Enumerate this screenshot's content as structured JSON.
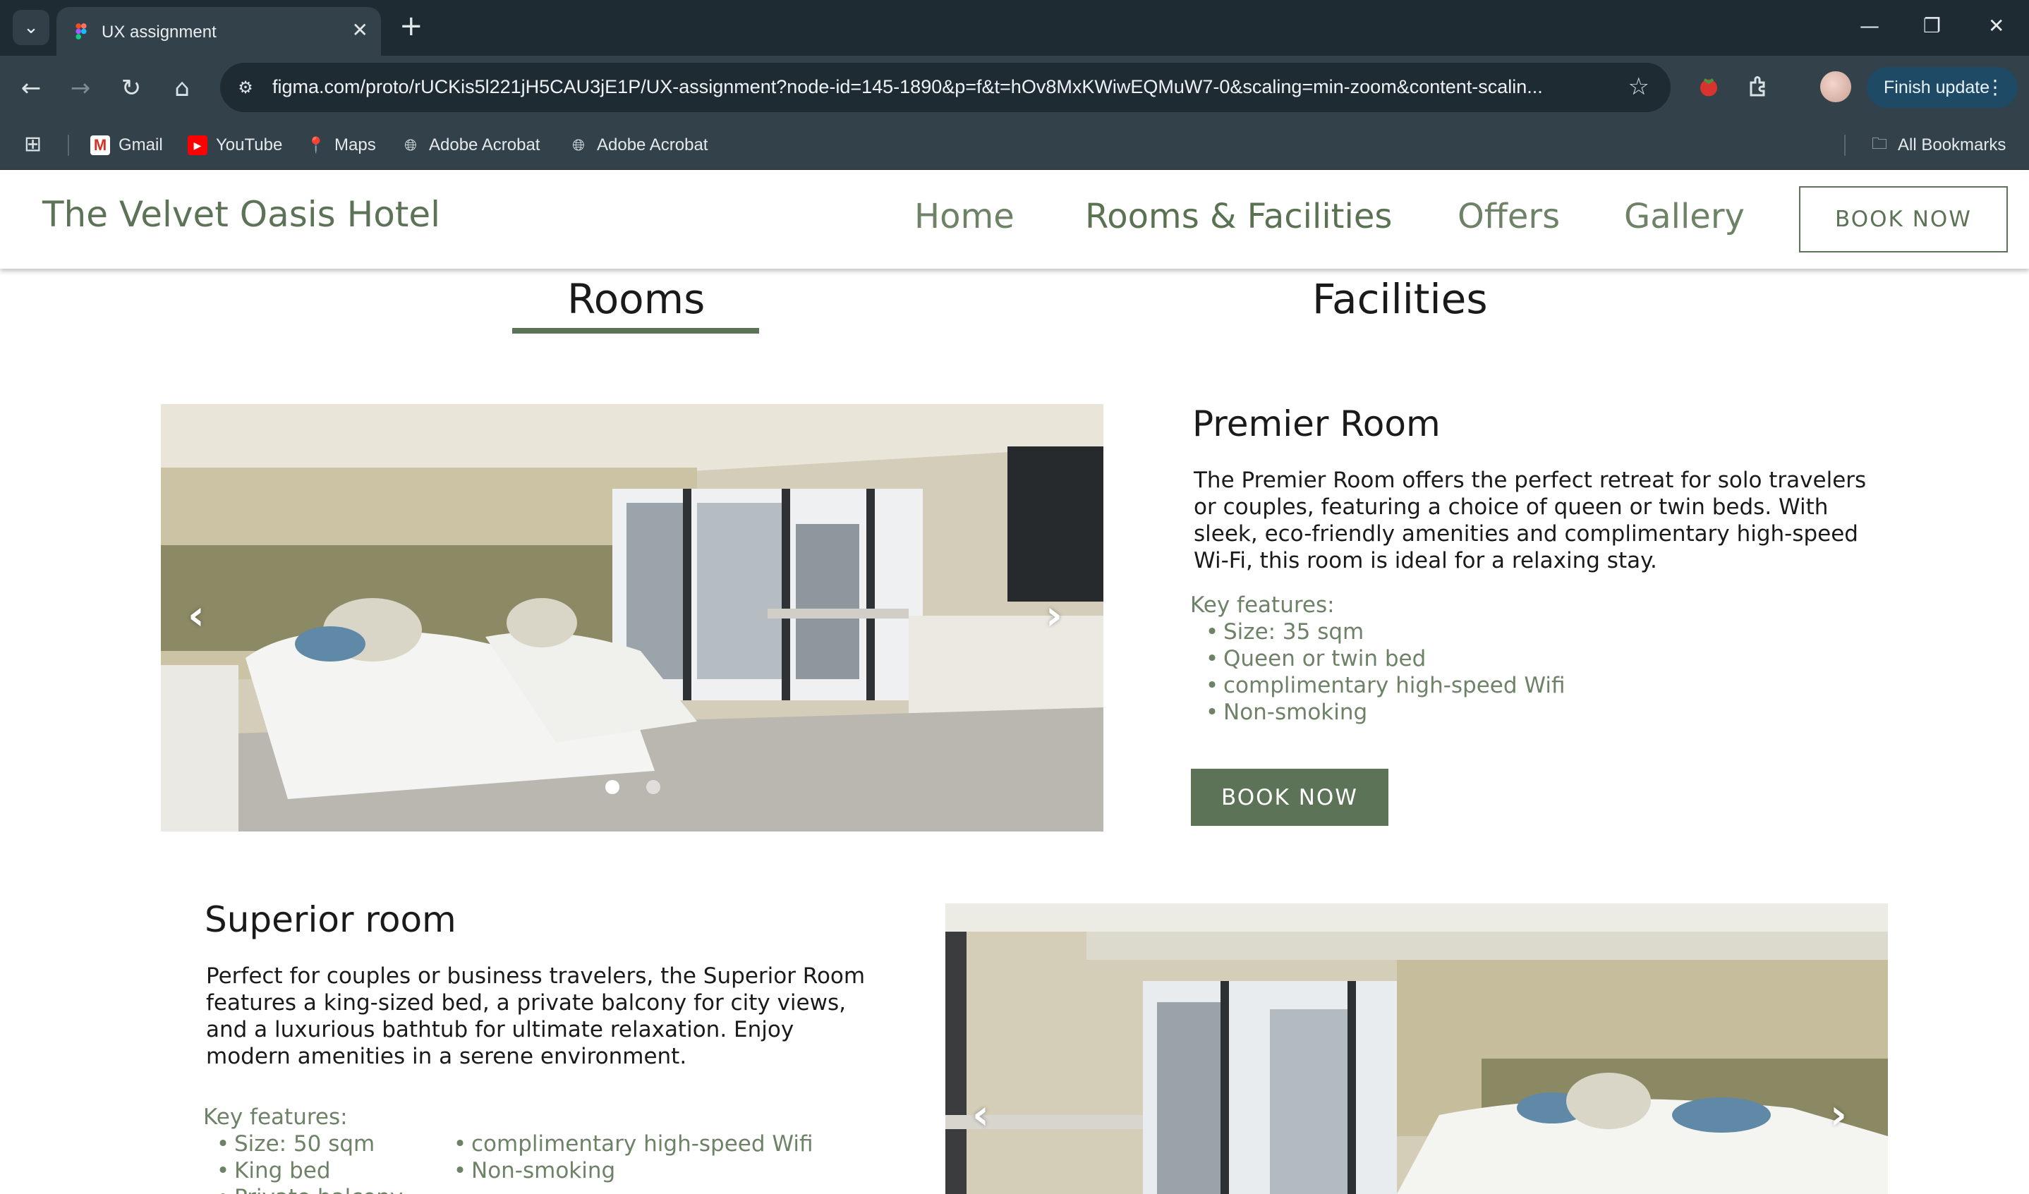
{
  "browser": {
    "tab_title": "UX assignment",
    "url": "figma.com/proto/rUCKis5l221jH5CAU3jE1P/UX-assignment?node-id=145-1890&p=f&t=hOv8MxKWiwEQMuW7-0&scaling=min-zoom&content-scalin...",
    "finish_update_label": "Finish update",
    "bookmarks": [
      {
        "label": "Gmail",
        "icon": "gmail-icon"
      },
      {
        "label": "YouTube",
        "icon": "youtube-icon"
      },
      {
        "label": "Maps",
        "icon": "maps-icon"
      },
      {
        "label": "Adobe Acrobat",
        "icon": "globe-icon"
      },
      {
        "label": "Adobe Acrobat",
        "icon": "globe-icon"
      }
    ],
    "all_bookmarks_label": "All Bookmarks"
  },
  "site": {
    "brand": "The Velvet Oasis Hotel",
    "nav": [
      "Home",
      "Rooms & Facilities",
      "Offers",
      "Gallery"
    ],
    "active_nav": "Rooms & Facilities",
    "book_now": "BOOK NOW",
    "accent_color": "#5d7357"
  },
  "tabs": {
    "rooms": "Rooms",
    "facilities": "Facilities",
    "active": "Rooms"
  },
  "premier": {
    "title": "Premier Room",
    "description": "The Premier Room offers the perfect retreat for solo travelers or couples, featuring a choice of queen or twin beds. With sleek, eco-friendly amenities and complimentary high-speed Wi-Fi, this room is ideal for a relaxing stay.",
    "features_label": "Key features:",
    "features": [
      "Size: 35 sqm",
      "Queen or twin bed",
      "complimentary high-speed Wifi",
      "Non-smoking"
    ],
    "book_now": "BOOK NOW",
    "carousel_slides": 2,
    "carousel_active": 1
  },
  "superior": {
    "title": "Superior room",
    "description": "Perfect for couples or business travelers, the Superior Room features a king-sized bed, a private balcony for city views, and a luxurious bathtub for ultimate relaxation. Enjoy modern amenities in a serene environment.",
    "features_label": "Key features:",
    "features_col1": [
      "Size: 50 sqm",
      "King bed",
      "Private balcony"
    ],
    "features_col2": [
      "complimentary high-speed Wifi",
      "Non-smoking"
    ]
  }
}
